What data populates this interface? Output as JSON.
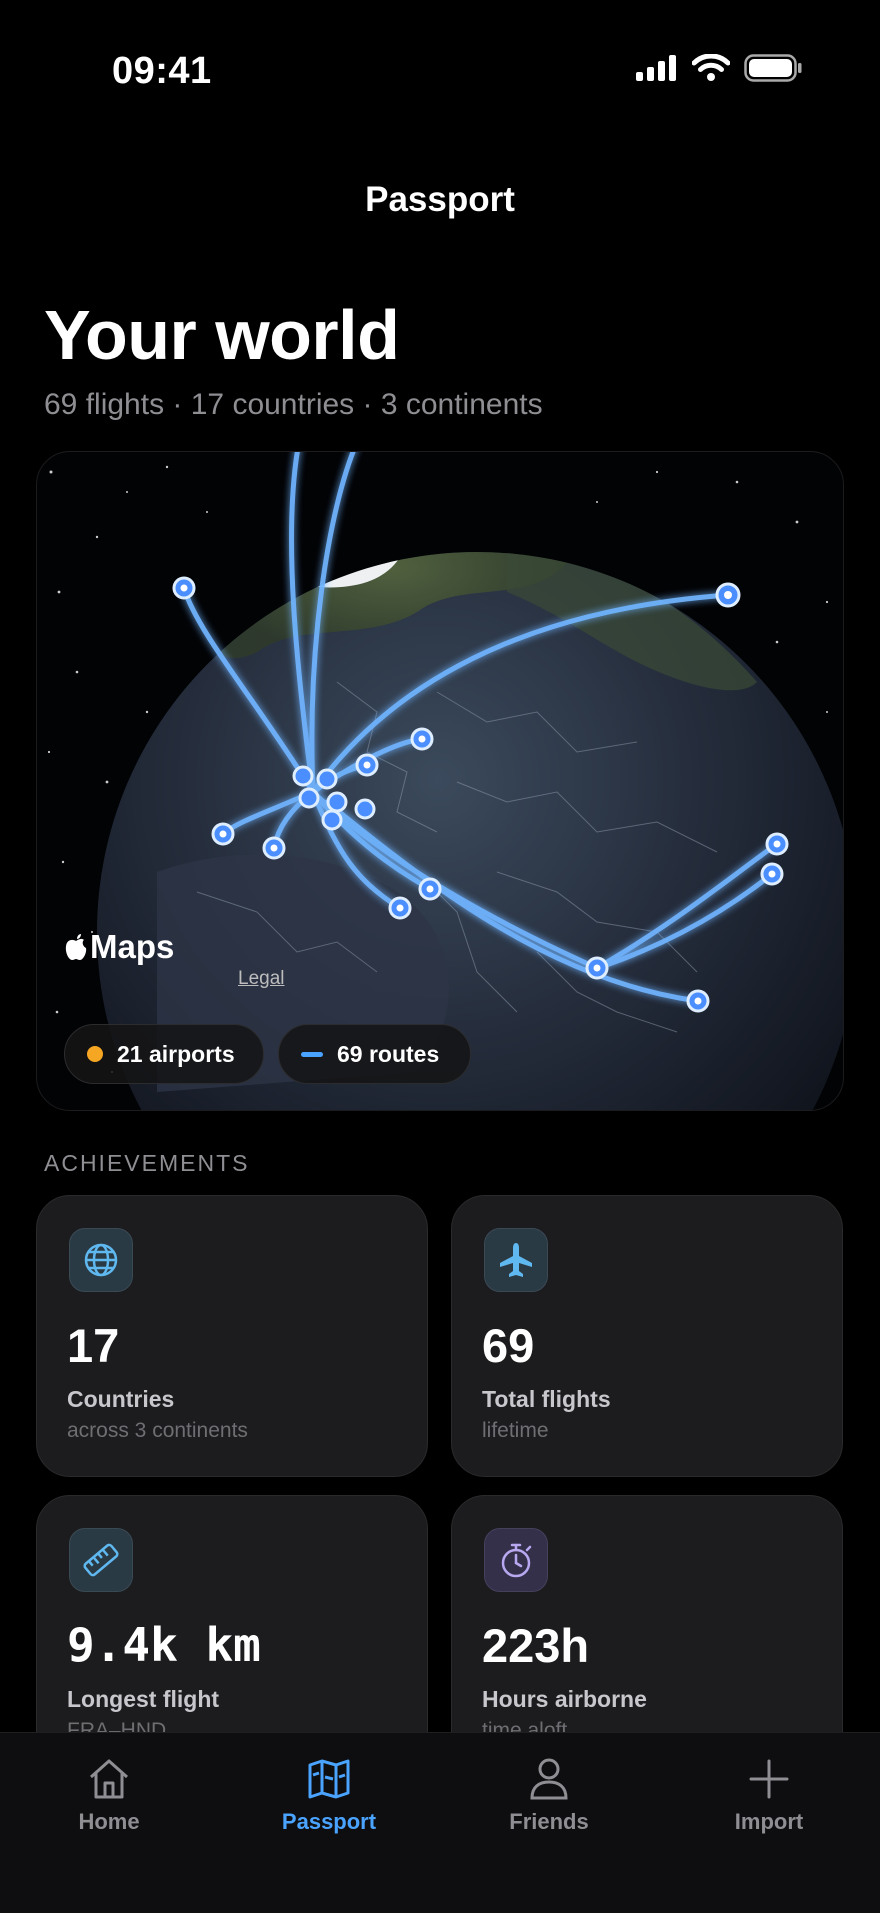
{
  "status_bar": {
    "time": "09:41"
  },
  "nav": {
    "title": "Passport"
  },
  "hero": {
    "title": "Your world",
    "subtitle": "69 flights · 17 countries · 3 continents"
  },
  "map": {
    "brand": "Maps",
    "legal": "Legal",
    "chips": {
      "airports": "21 airports",
      "routes": "69 routes"
    }
  },
  "achievements": {
    "section_label": "ACHIEVEMENTS",
    "cards": [
      {
        "icon": "globe-icon",
        "value": "17",
        "label": "Countries",
        "sub": "across 3 continents"
      },
      {
        "icon": "airplane-icon",
        "value": "69",
        "label": "Total flights",
        "sub": "lifetime"
      },
      {
        "icon": "ruler-icon",
        "value": "9.4k km",
        "label": "Longest flight",
        "sub": "FRA–HND"
      },
      {
        "icon": "stopwatch-icon",
        "value": "223h",
        "label": "Hours airborne",
        "sub": "time aloft"
      }
    ]
  },
  "tab_bar": {
    "tabs": [
      {
        "label": "Home",
        "icon": "home-icon",
        "active": false
      },
      {
        "label": "Passport",
        "icon": "map-icon",
        "active": true
      },
      {
        "label": "Friends",
        "icon": "person-icon",
        "active": false
      },
      {
        "label": "Import",
        "icon": "plus-icon",
        "active": false
      }
    ]
  },
  "colors": {
    "accent": "#4aa3ff",
    "airport_dot": "#f5a623",
    "background": "#000000",
    "card": "#1c1c1e"
  }
}
